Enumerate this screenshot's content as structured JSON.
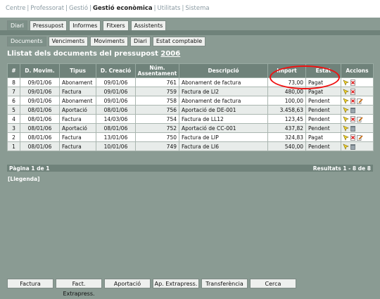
{
  "nav": {
    "items": [
      "Centre",
      "Professorat",
      "Gestió",
      "Gestió econòmica",
      "Utilitats",
      "Sistema"
    ],
    "current": "Gestió econòmica"
  },
  "tabs_main": [
    "Diari",
    "Pressupost",
    "Informes",
    "Fitxers",
    "Assistents"
  ],
  "tabs_main_active": "Diari",
  "tabs_sub": [
    "Documents",
    "Venciments",
    "Moviments",
    "Diari",
    "Estat comptable"
  ],
  "tabs_sub_active": "Documents",
  "page_title": "Llistat dels documents del pressupost",
  "page_year": "2006",
  "table": {
    "headers": [
      "#",
      "D. Movim.",
      "Tipus",
      "D. Creació",
      "Núm. Assentament",
      "Descripció",
      "Import",
      "Estat",
      "Accions"
    ],
    "rows": [
      {
        "n": "8",
        "dmov": "09/01/06",
        "tipus": "Abonament",
        "dcre": "09/01/06",
        "num": "761",
        "desc": "Abonament de factura",
        "import": "73,00",
        "estat": "Pagat",
        "actions": [
          "select",
          "delete"
        ]
      },
      {
        "n": "7",
        "dmov": "09/01/06",
        "tipus": "Factura",
        "dcre": "09/01/06",
        "num": "759",
        "desc": "Factura de LI2",
        "import": "480,00",
        "estat": "Pagat",
        "actions": [
          "select",
          "delete"
        ]
      },
      {
        "n": "6",
        "dmov": "09/01/06",
        "tipus": "Abonament",
        "dcre": "09/01/06",
        "num": "758",
        "desc": "Abonament de factura",
        "import": "100,00",
        "estat": "Pendent",
        "actions": [
          "select",
          "delete",
          "edit"
        ]
      },
      {
        "n": "5",
        "dmov": "08/01/06",
        "tipus": "Aportació",
        "dcre": "08/01/06",
        "num": "756",
        "desc": "Aportació de DE-001",
        "import": "3.458,63",
        "estat": "Pendent",
        "actions": [
          "select",
          "trash"
        ]
      },
      {
        "n": "4",
        "dmov": "08/01/06",
        "tipus": "Factura",
        "dcre": "14/03/06",
        "num": "754",
        "desc": "Factura de LL12",
        "import": "123,45",
        "estat": "Pendent",
        "actions": [
          "select",
          "delete",
          "edit"
        ]
      },
      {
        "n": "3",
        "dmov": "08/01/06",
        "tipus": "Aportació",
        "dcre": "08/01/06",
        "num": "752",
        "desc": "Aportació de CC-001",
        "import": "437,82",
        "estat": "Pendent",
        "actions": [
          "select",
          "trash"
        ]
      },
      {
        "n": "2",
        "dmov": "08/01/06",
        "tipus": "Factura",
        "dcre": "13/01/06",
        "num": "750",
        "desc": "Factura de LIP",
        "import": "324,83",
        "estat": "Pagat",
        "actions": [
          "select",
          "delete",
          "edit"
        ]
      },
      {
        "n": "1",
        "dmov": "08/01/06",
        "tipus": "Factura",
        "dcre": "10/01/06",
        "num": "749",
        "desc": "Factura de LI6",
        "import": "540,00",
        "estat": "Pendent",
        "actions": [
          "select",
          "trash"
        ]
      }
    ]
  },
  "footer": {
    "pages": "Pàgina 1 de 1",
    "results": "Resultats 1 - 8 de 8"
  },
  "legend": "[Llegenda]",
  "bottom_buttons": [
    "Factura",
    "Fact. Extrapress.",
    "Aportació",
    "Ap. Extrapress.",
    "Transferència",
    "Cerca"
  ],
  "colors": {
    "header_bg": "#6f827a",
    "page_bg": "#8a9b93",
    "highlight": "#e11"
  }
}
